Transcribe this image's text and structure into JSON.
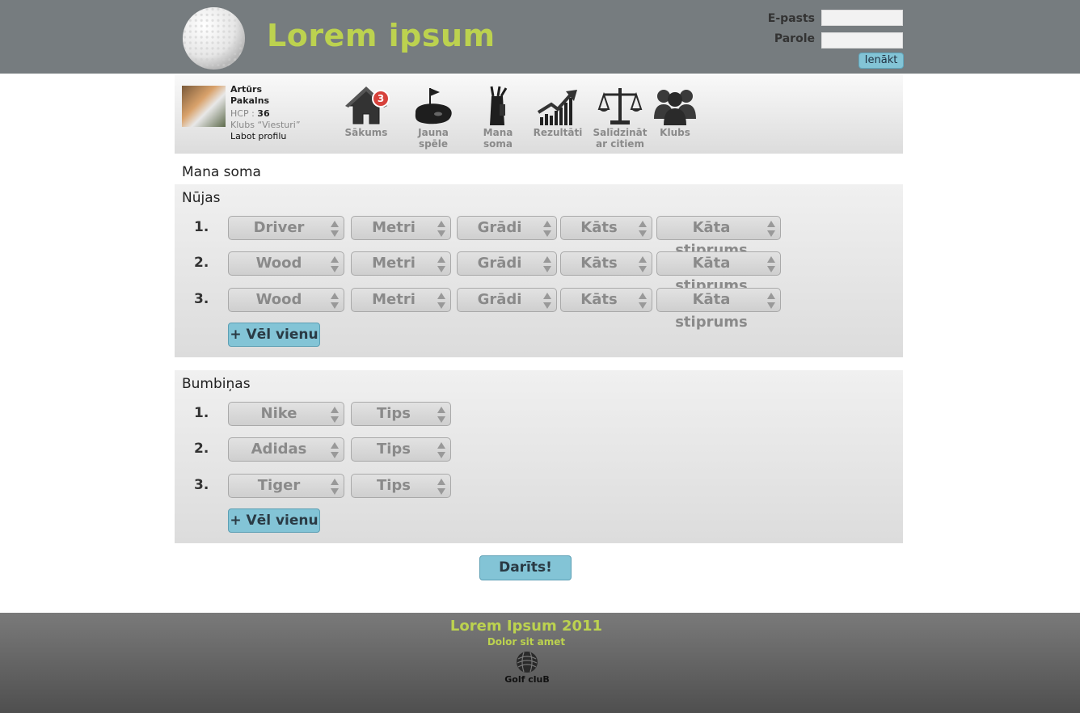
{
  "header": {
    "title": "Lorem ipsum",
    "email_label": "E-pasts",
    "password_label": "Parole",
    "login_button": "Ienākt"
  },
  "profile": {
    "first_name": "Artūrs",
    "last_name": "Pakalns",
    "hcp_label": "HCP :",
    "hcp_value": "36",
    "club": "Klubs “Viesturi”",
    "edit_link": "Labot profilu"
  },
  "nav": {
    "items": [
      {
        "label": "Sākums",
        "icon": "home-icon",
        "badge": "3"
      },
      {
        "label": "Jauna spēle",
        "icon": "golf-hole-icon"
      },
      {
        "label": "Mana soma",
        "icon": "golf-bag-icon"
      },
      {
        "label": "Rezultāti",
        "icon": "chart-icon"
      },
      {
        "label_line1": "Salīdzināt",
        "label_line2": "ar citiem",
        "icon": "scales-icon"
      },
      {
        "label": "Klubs",
        "icon": "people-icon"
      }
    ]
  },
  "page_title": "Mana soma",
  "clubs_section": {
    "title": "Nūjas",
    "rows": [
      {
        "num": "1.",
        "club": "Driver",
        "meters": "Metri",
        "degrees": "Grādi",
        "shaft": "Kāts",
        "flex": "Kāta stiprums"
      },
      {
        "num": "2.",
        "club": "Wood",
        "meters": "Metri",
        "degrees": "Grādi",
        "shaft": "Kāts",
        "flex": "Kāta stiprums"
      },
      {
        "num": "3.",
        "club": "Wood",
        "meters": "Metri",
        "degrees": "Grādi",
        "shaft": "Kāts",
        "flex": "Kāta stiprums"
      }
    ],
    "add_button": "+ Vēl vienu"
  },
  "balls_section": {
    "title": "Bumbiņas",
    "rows": [
      {
        "num": "1.",
        "brand": "Nike",
        "type": "Tips"
      },
      {
        "num": "2.",
        "brand": "Adidas",
        "type": "Tips"
      },
      {
        "num": "3.",
        "brand": "Tiger",
        "type": "Tips"
      }
    ],
    "add_button": "+ Vēl vienu"
  },
  "done_button": "Darīts!",
  "footer": {
    "title": "Lorem Ipsum 2011",
    "subtitle": "Dolor sit amet",
    "logo_text": "Golf cluB"
  },
  "colors": {
    "header_bg": "#767c7f",
    "accent_green": "#bcd24f",
    "button_blue": "#83c4d6",
    "badge_red": "#d7423c"
  }
}
